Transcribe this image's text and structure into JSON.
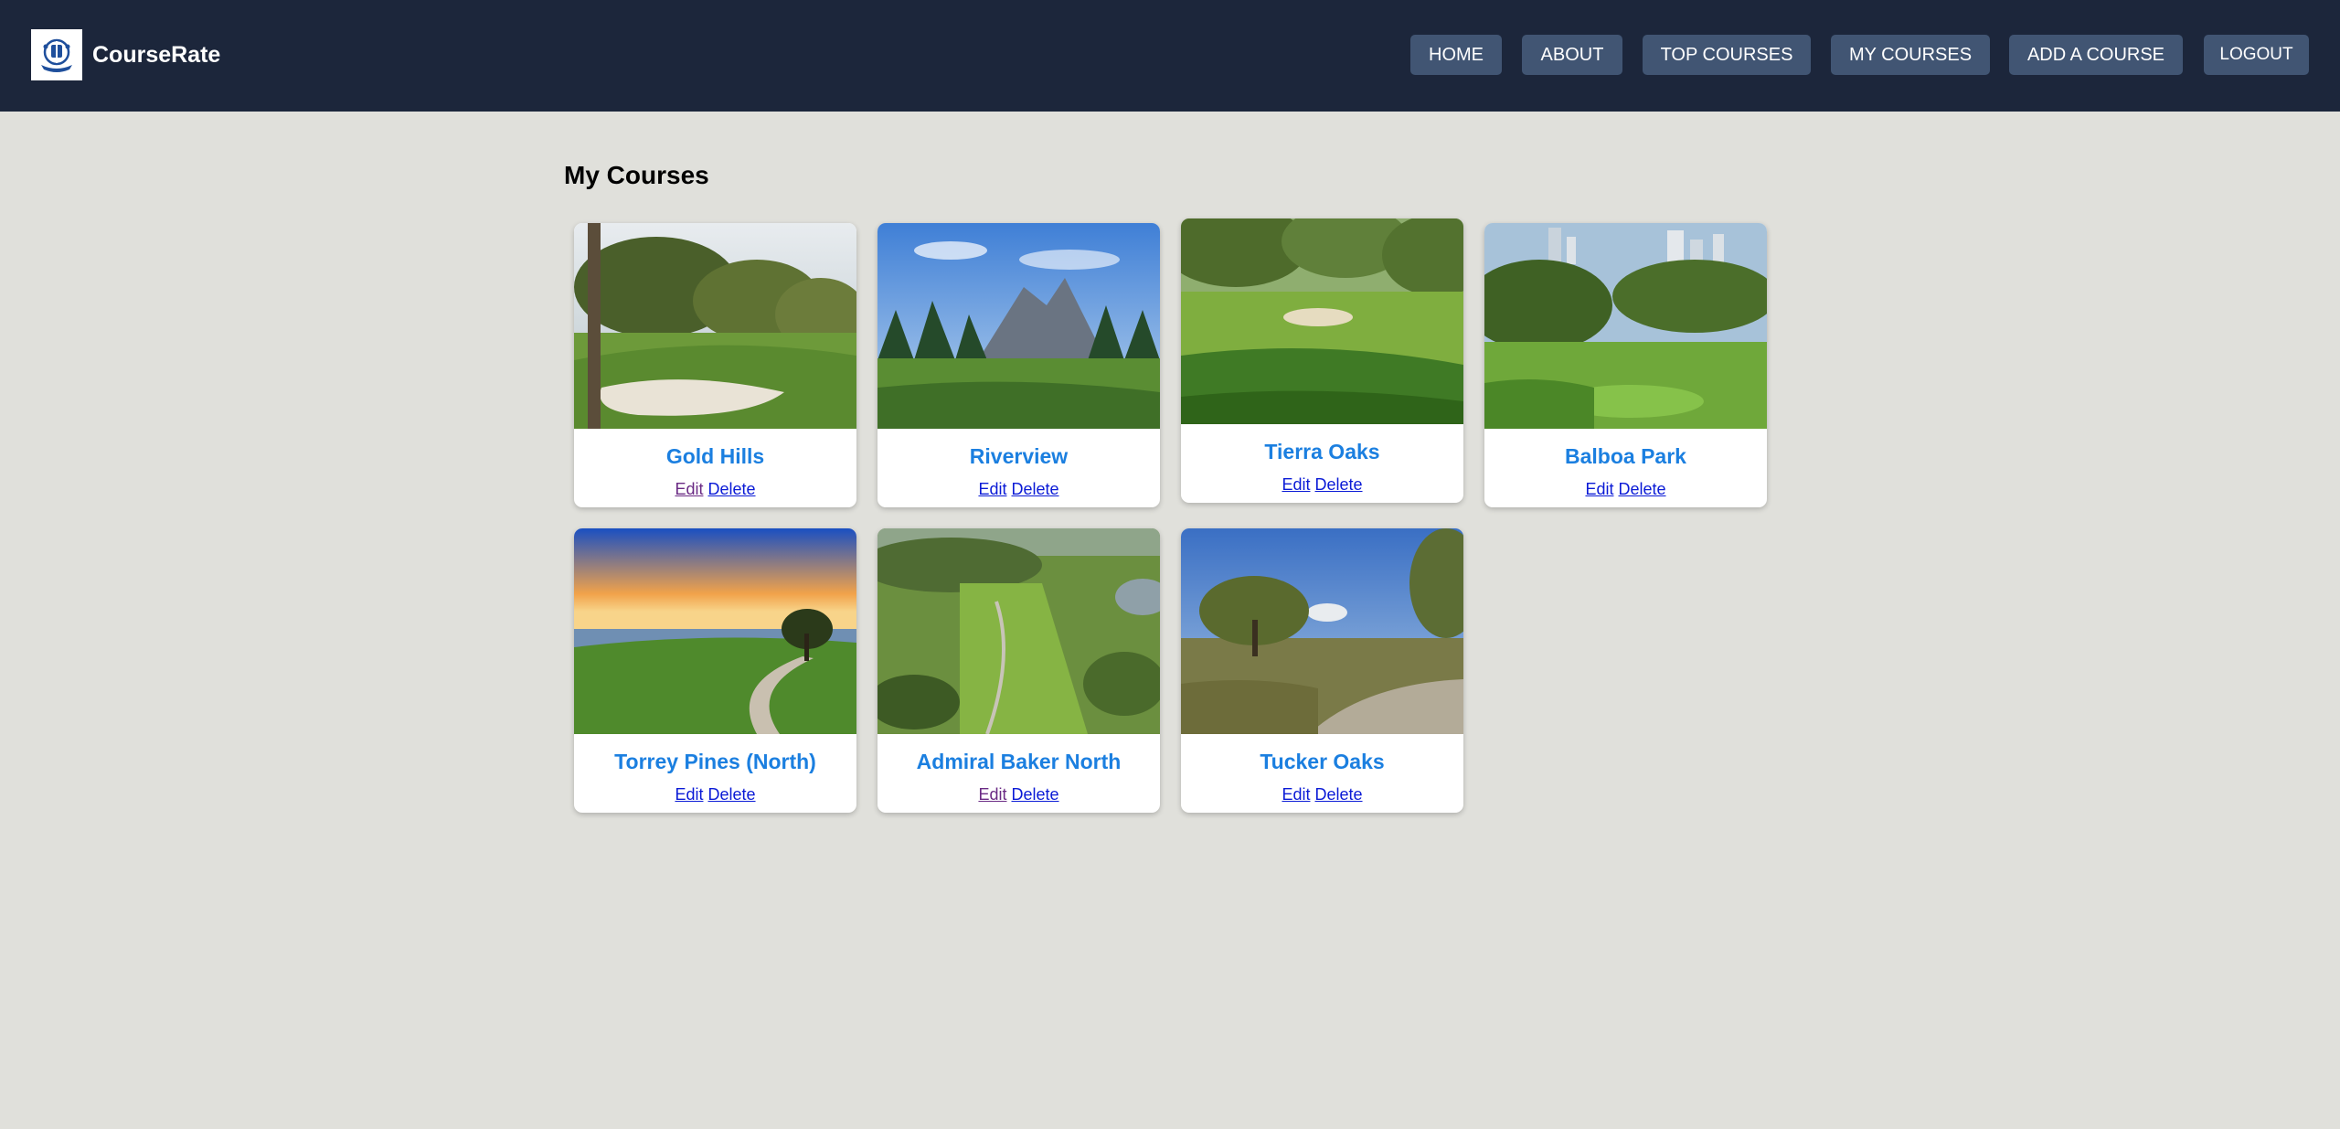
{
  "header": {
    "brand": "CourseRate",
    "logo_icon": "golf-crest-logo-icon",
    "nav": [
      {
        "label": "HOME"
      },
      {
        "label": "ABOUT"
      },
      {
        "label": "TOP COURSES"
      },
      {
        "label": "MY COURSES"
      },
      {
        "label": "ADD A COURSE"
      },
      {
        "label": "LOGOUT"
      }
    ]
  },
  "main": {
    "title": "My Courses",
    "courses": [
      {
        "name": "Gold Hills",
        "edit": "Edit",
        "delete": "Delete"
      },
      {
        "name": "Riverview",
        "edit": "Edit",
        "delete": "Delete"
      },
      {
        "name": "Tierra Oaks",
        "edit": "Edit",
        "delete": "Delete"
      },
      {
        "name": "Balboa Park",
        "edit": "Edit",
        "delete": "Delete"
      },
      {
        "name": "Torrey Pines (North)",
        "edit": "Edit",
        "delete": "Delete"
      },
      {
        "name": "Admiral Baker North",
        "edit": "Edit",
        "delete": "Delete"
      },
      {
        "name": "Tucker Oaks",
        "edit": "Edit",
        "delete": "Delete"
      }
    ]
  },
  "colors": {
    "header_bg": "#1c263b",
    "nav_button_bg": "#415573",
    "page_bg": "#e0e0db",
    "course_name": "#1b7fe0",
    "link": "#0a1ad6",
    "link_visited": "#6a2a84"
  }
}
